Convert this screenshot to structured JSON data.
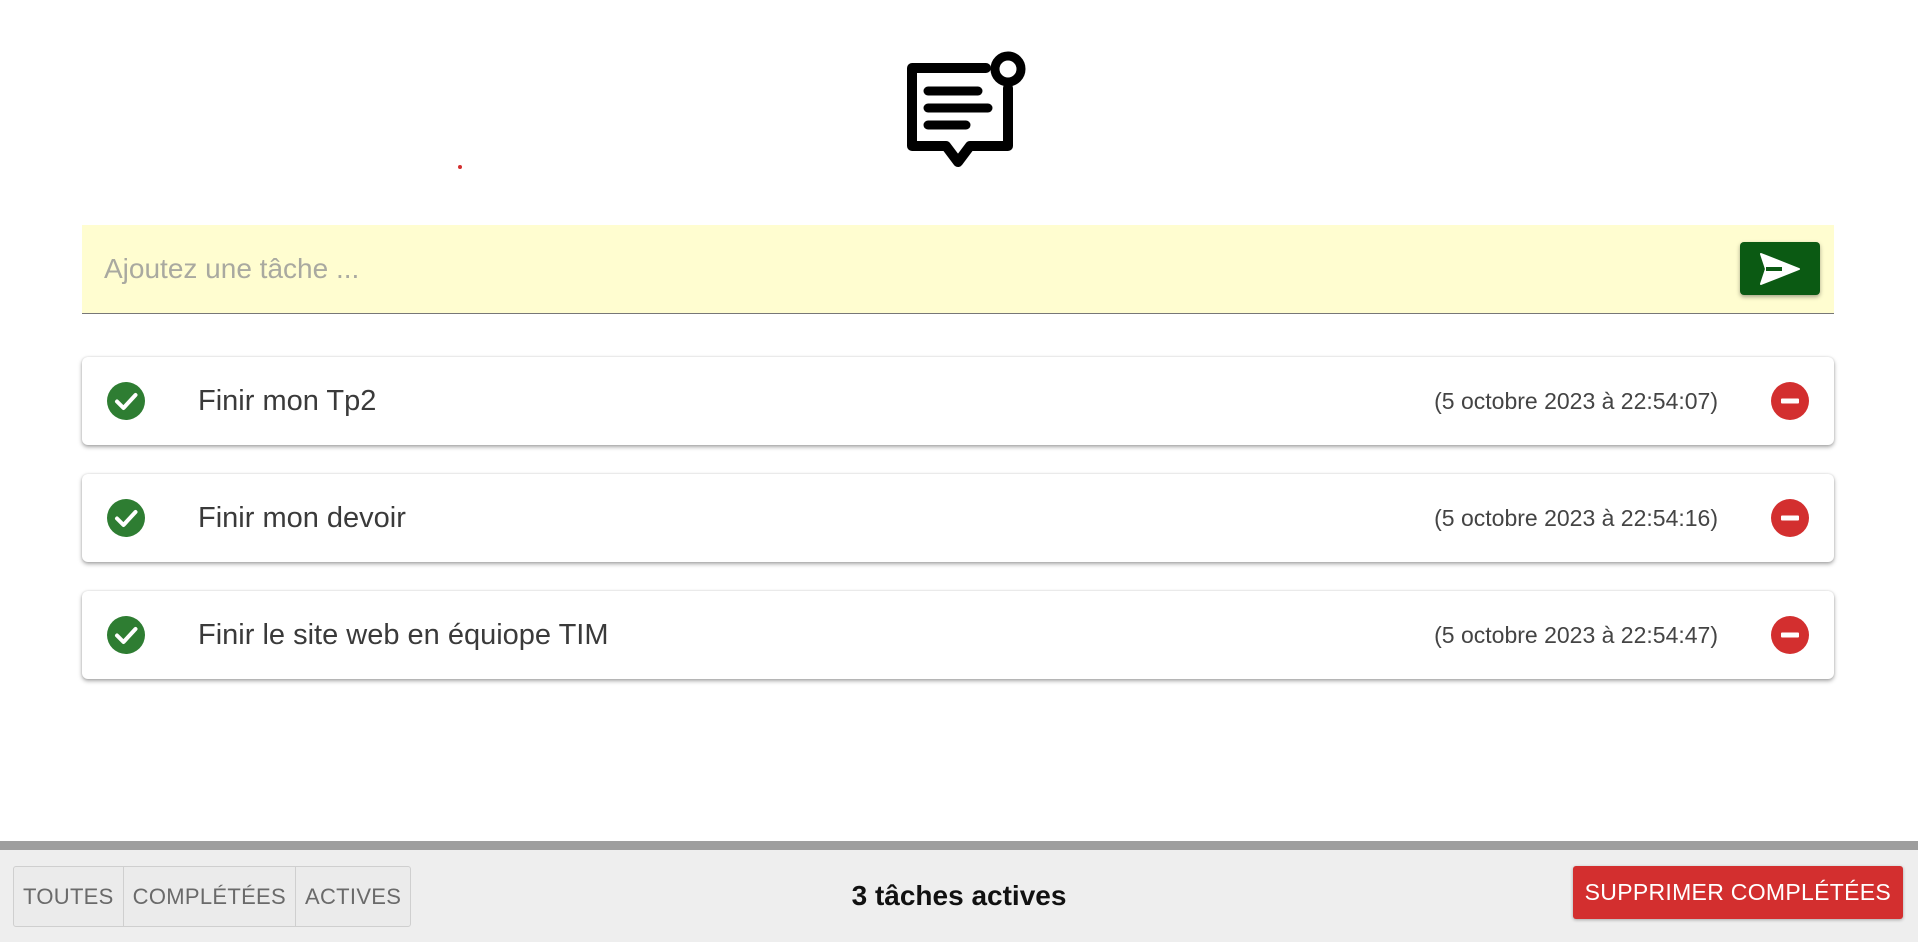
{
  "logo": {
    "icon": "message-note-icon"
  },
  "add_task": {
    "placeholder": "Ajoutez une tâche ...",
    "value": "",
    "send_icon": "send-icon",
    "send_color": "#0b5a13"
  },
  "tasks": [
    {
      "text": "Finir mon Tp2",
      "date": "(5 octobre 2023 à 22:54:07)"
    },
    {
      "text": "Finir mon devoir",
      "date": "(5 octobre 2023 à 22:54:16)"
    },
    {
      "text": "Finir le site web en équiope TIM",
      "date": "(5 octobre 2023 à 22:54:47)"
    }
  ],
  "colors": {
    "check": "#2e7d32",
    "remove": "#d32f2f",
    "input_bg": "#fffdd0",
    "footer_bg": "#eeeeee"
  },
  "footer": {
    "filters": [
      "TOUTES",
      "COMPLÉTÉES",
      "ACTIVES"
    ],
    "active_count": "3 tâches actives",
    "clear_label": "SUPPRIMER COMPLÉTÉES"
  }
}
